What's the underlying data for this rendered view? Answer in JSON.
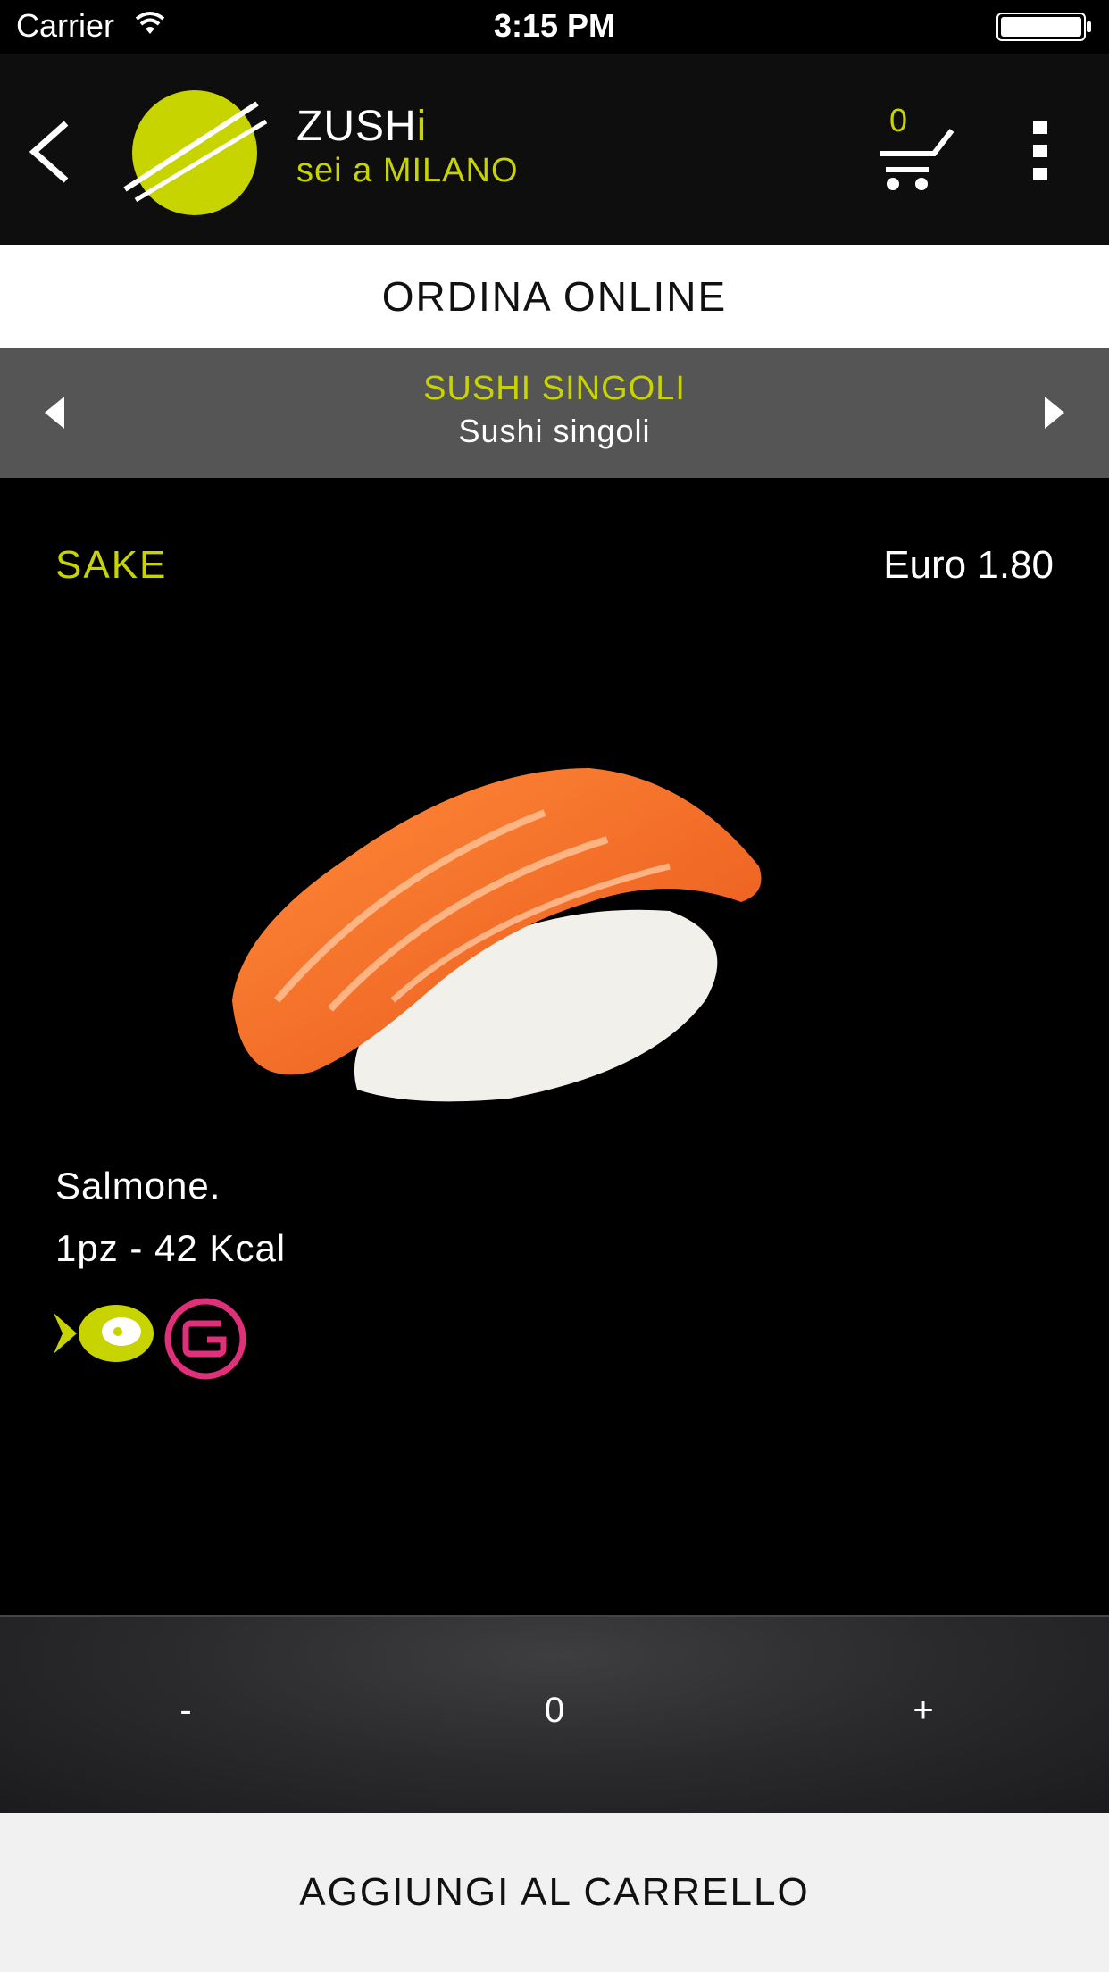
{
  "status_bar": {
    "carrier": "Carrier",
    "time": "3:15 PM"
  },
  "header": {
    "brand_main": "ZUSH",
    "brand_accent": "i",
    "location": "sei a MILANO",
    "cart_count": "0"
  },
  "section_title": "ORDINA ONLINE",
  "category": {
    "title": "SUSHI SINGOLI",
    "subtitle": "Sushi singoli"
  },
  "product": {
    "name": "SAKE",
    "price": "Euro 1.80",
    "description": "Salmone.",
    "details": "1pz - 42 Kcal",
    "icons": [
      "fish-icon",
      "gluten-icon"
    ]
  },
  "quantity": {
    "minus_label": "-",
    "value": "0",
    "plus_label": "+"
  },
  "add_to_cart_label": "AGGIUNGI AL CARRELLO",
  "colors": {
    "accent": "#c8d400",
    "header_bg": "#0e0e0e",
    "category_bg": "#555555",
    "gluten": "#e0307a"
  }
}
